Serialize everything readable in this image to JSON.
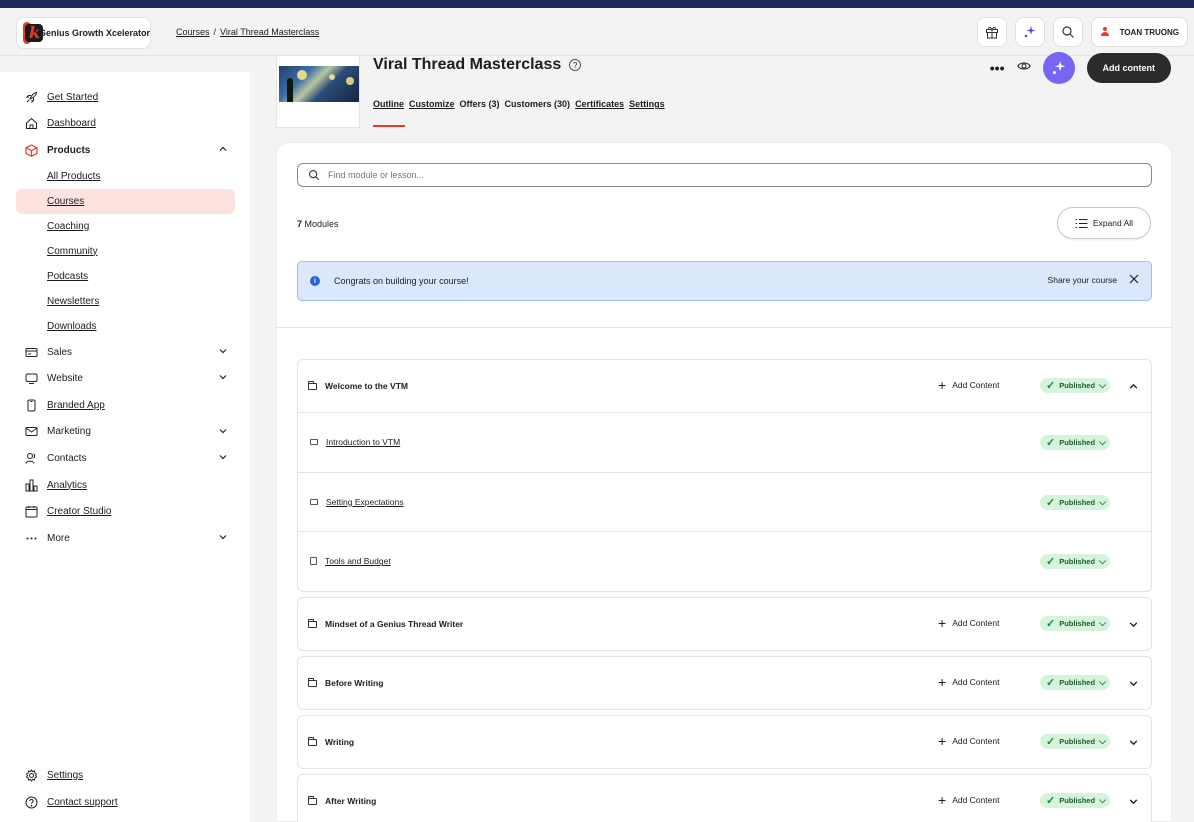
{
  "brand": {
    "name": "Genius Growth Xcelerator",
    "logo_letter": "k"
  },
  "breadcrumb": {
    "root": "Courses",
    "separator": "/",
    "current": "Viral Thread Masterclass"
  },
  "user": {
    "name": "TOAN TRUONG"
  },
  "sidebar": {
    "get_started": "Get Started",
    "dashboard": "Dashboard",
    "products": "Products",
    "products_sub": [
      "All Products",
      "Courses",
      "Coaching",
      "Community",
      "Podcasts",
      "Newsletters",
      "Downloads"
    ],
    "sales": "Sales",
    "website": "Website",
    "branded_app": "Branded App",
    "marketing": "Marketing",
    "contacts": "Contacts",
    "analytics": "Analytics",
    "creator_studio": "Creator Studio",
    "more": "More",
    "settings": "Settings",
    "contact_support": "Contact support"
  },
  "course": {
    "title": "Viral Thread Masterclass",
    "tabs": [
      "Outline",
      "Customize",
      "Offers (3)",
      "Customers (30)",
      "Certificates",
      "Settings"
    ],
    "add_content_label": "Add content"
  },
  "outline": {
    "search_placeholder": "Find module or lesson...",
    "modules_count": "7",
    "modules_label": "Modules",
    "expand_all": "Expand All",
    "banner_text": "Congrats on building your course!",
    "share_label": "Share your course",
    "add_content": "Add Content",
    "published": "Published",
    "modules": [
      {
        "title": "Welcome to the VTM",
        "status": "Published",
        "expanded": true,
        "lessons": [
          {
            "title": "Introduction to VTM",
            "type": "video",
            "status": "Published"
          },
          {
            "title": "Setting Expectations",
            "type": "video",
            "status": "Published"
          },
          {
            "title": "Tools and Budget",
            "type": "document",
            "status": "Published"
          }
        ]
      },
      {
        "title": "Mindset of a Genius Thread Writer",
        "status": "Published"
      },
      {
        "title": "Before Writing",
        "status": "Published"
      },
      {
        "title": "Writing",
        "status": "Published"
      },
      {
        "title": "After Writing",
        "status": "Published"
      }
    ]
  },
  "colors": {
    "accent": "#e8392c",
    "ai_purple": "#7865f3",
    "published_bg": "#d6f3dc",
    "banner_bg": "#dbe7fb"
  }
}
